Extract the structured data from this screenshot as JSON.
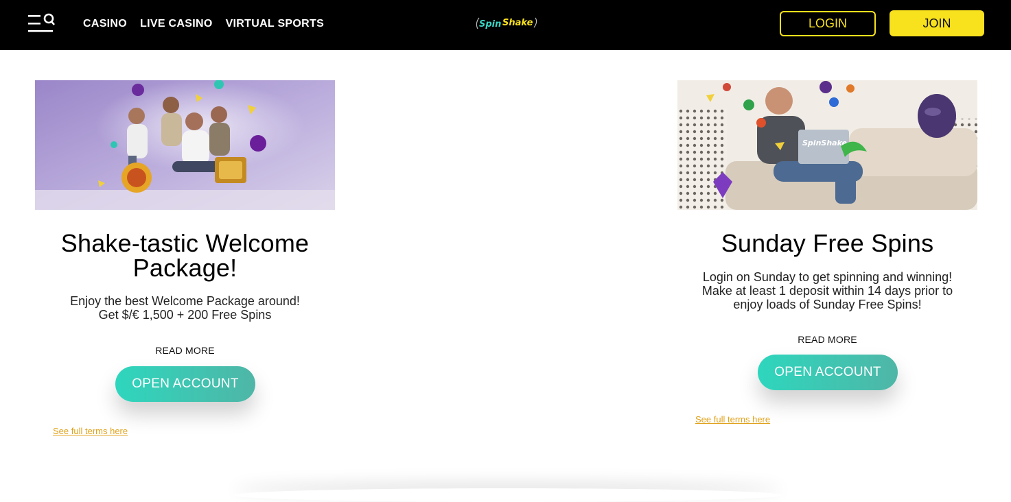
{
  "header": {
    "menu_icon": "menu-search-icon",
    "nav": [
      "CASINO",
      "LIVE CASINO",
      "VIRTUAL SPORTS"
    ],
    "logo_text": "SpinShake",
    "login_label": "LOGIN",
    "join_label": "JOIN"
  },
  "colors": {
    "header_bg": "#000000",
    "accent_yellow": "#f8e11d",
    "button_teal": "#2ed6bd",
    "terms_link": "#e0a21b"
  },
  "promos": [
    {
      "title_lines": [
        "Shake-tastic Welcome",
        "Package!"
      ],
      "description_lines": [
        "Enjoy the best Welcome Package around!",
        "Get $/€ 1,500 + 200 Free Spins"
      ],
      "read_more": "READ MORE",
      "cta": "OPEN ACCOUNT",
      "terms": "See full terms here"
    },
    {
      "title_lines": [
        "Sunday Free Spins"
      ],
      "description_lines": [
        "Login on Sunday to get spinning and winning!",
        "Make at least 1 deposit within 14 days prior to",
        "enjoy loads of Sunday Free Spins!"
      ],
      "read_more": "READ MORE",
      "cta": "OPEN ACCOUNT",
      "terms": "See full terms here",
      "laptop_logo_text": "SpinShake"
    }
  ]
}
